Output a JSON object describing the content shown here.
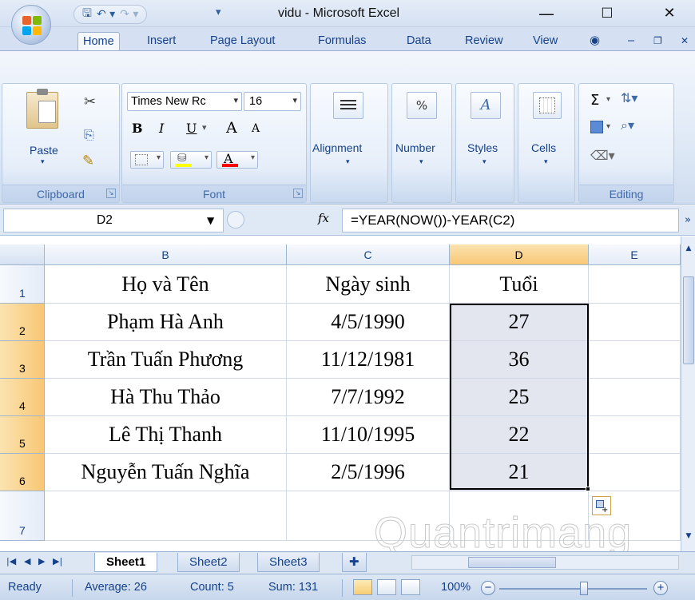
{
  "window": {
    "title": "vidu - Microsoft Excel",
    "minimize": "—",
    "maximize": "☐",
    "close": "✕"
  },
  "qat": {
    "save_icon": "save-icon",
    "undo_icon": "undo-icon",
    "redo_icon": "redo-icon",
    "customize": "▾"
  },
  "tabs": [
    "Home",
    "Insert",
    "Page Layout",
    "Formulas",
    "Data",
    "Review",
    "View"
  ],
  "ribbon": {
    "clipboard": {
      "label": "Clipboard",
      "paste": "Paste"
    },
    "font": {
      "label": "Font",
      "name": "Times New Rc",
      "size": "16",
      "bold": "B",
      "italic": "I",
      "underline": "U",
      "grow": "A",
      "shrink": "A",
      "font_color": "A"
    },
    "alignment": {
      "label": "Alignment"
    },
    "number": {
      "label": "Number",
      "icon_text": "%"
    },
    "styles": {
      "label": "Styles"
    },
    "cells": {
      "label": "Cells"
    },
    "editing": {
      "label": "Editing",
      "sum": "Σ"
    }
  },
  "formula_bar": {
    "name_box": "D2",
    "fx": "fx",
    "formula": "=YEAR(NOW())-YEAR(C2)"
  },
  "grid": {
    "columns": [
      "B",
      "C",
      "D",
      "E"
    ],
    "selected_column": "D",
    "rows": [
      {
        "num": "1",
        "cells": [
          "Họ và Tên",
          "Ngày sinh",
          "Tuổi",
          ""
        ]
      },
      {
        "num": "2",
        "cells": [
          "Phạm Hà Anh",
          "4/5/1990",
          "27",
          ""
        ]
      },
      {
        "num": "3",
        "cells": [
          "Trần Tuấn Phương",
          "11/12/1981",
          "36",
          ""
        ]
      },
      {
        "num": "4",
        "cells": [
          "Hà Thu Thảo",
          "7/7/1992",
          "25",
          ""
        ]
      },
      {
        "num": "5",
        "cells": [
          "Lê Thị Thanh",
          "11/10/1995",
          "22",
          ""
        ]
      },
      {
        "num": "6",
        "cells": [
          "Nguyễn Tuấn Nghĩa",
          "2/5/1996",
          "21",
          ""
        ]
      },
      {
        "num": "7",
        "cells": [
          "",
          "",
          "",
          ""
        ]
      }
    ]
  },
  "sheets": [
    "Sheet1",
    "Sheet2",
    "Sheet3"
  ],
  "active_sheet": "Sheet1",
  "status": {
    "mode": "Ready",
    "average": "Average: 26",
    "count": "Count: 5",
    "sum": "Sum: 131",
    "zoom": "100%"
  },
  "colors": {
    "ribbon_blue": "#d5e1f2",
    "selected_header": "#f8c775",
    "text_blue": "#15428b"
  }
}
